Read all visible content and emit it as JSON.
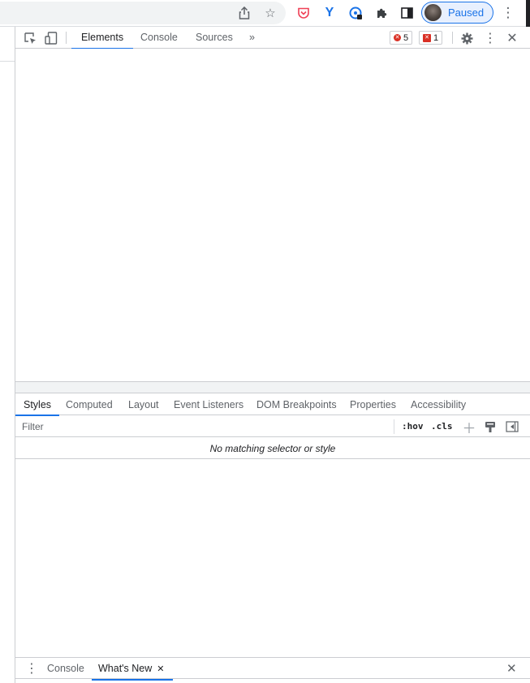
{
  "chrome": {
    "toolbar_icons": [
      "share-icon",
      "bookmark-star-icon"
    ],
    "extensions": [
      {
        "name": "pocket-extension-icon",
        "glyph": "⛉",
        "color": "#ef4056"
      },
      {
        "name": "y-extension-icon",
        "glyph": "Y",
        "color": "#1a73e8"
      },
      {
        "name": "gauge-extension-icon",
        "glyph": "◔",
        "color": "#1a73e8"
      },
      {
        "name": "puzzle-extensions-icon",
        "glyph": "✚",
        "color": "#3c4043"
      },
      {
        "name": "side-panel-icon",
        "glyph": "◧",
        "color": "#3c4043"
      }
    ],
    "profile_label": "Paused",
    "accent": "#1a73e8"
  },
  "devtools": {
    "main_tabs": [
      "Elements",
      "Console",
      "Sources"
    ],
    "more_tabs": "»",
    "errors_count": "5",
    "warnings_count": "1",
    "side_tabs": [
      "Styles",
      "Computed",
      "Layout",
      "Event Listeners",
      "DOM Breakpoints",
      "Properties",
      "Accessibility"
    ],
    "filter_placeholder": "Filter",
    "hov_label": ":hov",
    "cls_label": ".cls",
    "no_match_text": "No matching selector or style",
    "drawer_tabs": {
      "console": "Console",
      "whats_new": "What's New"
    }
  }
}
